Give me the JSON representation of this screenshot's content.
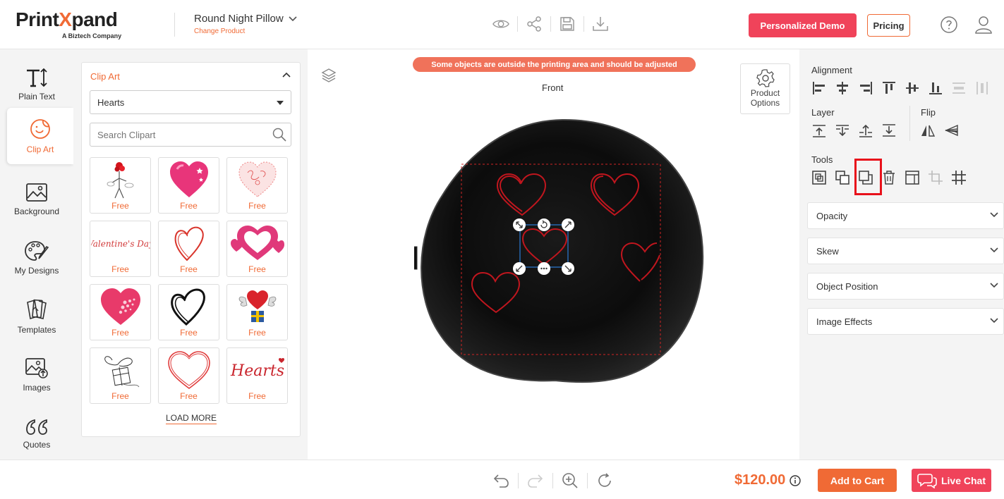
{
  "header": {
    "logo_text_a": "Print",
    "logo_text_x": "X",
    "logo_text_b": "pand",
    "logo_tagline": "A Biztech Company",
    "product_name": "Round Night Pillow",
    "change_product": "Change Product",
    "icons": [
      "eye-icon",
      "share-icon",
      "save-icon",
      "download-icon"
    ],
    "demo_button": "Personalized Demo",
    "pricing_button": "Pricing",
    "colors": {
      "accent": "#f06a35",
      "demo": "#f0435a"
    }
  },
  "left_tools": [
    {
      "label": "Plain Text",
      "icon": "text-icon"
    },
    {
      "label": "Clip Art",
      "icon": "clipart-icon",
      "active": true
    },
    {
      "label": "Background",
      "icon": "background-icon"
    },
    {
      "label": "My Designs",
      "icon": "palette-icon"
    },
    {
      "label": "Templates",
      "icon": "templates-icon"
    },
    {
      "label": "Images",
      "icon": "images-icon"
    },
    {
      "label": "Quotes",
      "icon": "quotes-icon"
    }
  ],
  "clipart": {
    "title": "Clip Art",
    "category": "Hearts",
    "search_placeholder": "Search Clipart",
    "tiles": [
      {
        "label": "Free",
        "icon": "rose-figure-clipart"
      },
      {
        "label": "Free",
        "icon": "pink-heart-stars-clipart"
      },
      {
        "label": "Free",
        "icon": "swirl-heart-clipart"
      },
      {
        "label": "Free",
        "icon": "valentines-day-text-clipart",
        "text": "Valentine's Day"
      },
      {
        "label": "Free",
        "icon": "sketch-heart-clipart"
      },
      {
        "label": "Free",
        "icon": "double-hearts-clipart"
      },
      {
        "label": "Free",
        "icon": "dotted-heart-clipart"
      },
      {
        "label": "Free",
        "icon": "black-scribble-heart-clipart"
      },
      {
        "label": "Free",
        "icon": "winged-heart-gift-clipart"
      },
      {
        "label": "Free",
        "icon": "heart-gift-sketch-clipart"
      },
      {
        "label": "Free",
        "icon": "outline-heart-clipart"
      },
      {
        "label": "Free",
        "icon": "hearts-text-clipart",
        "text": "Hearts"
      }
    ],
    "load_more": "LOAD MORE"
  },
  "canvas": {
    "warning": "Some objects are outside the printing area and should be adjusted",
    "view_label": "Front",
    "product_options": [
      "Product",
      "Options"
    ]
  },
  "right_panel": {
    "alignment_label": "Alignment",
    "layer_label": "Layer",
    "flip_label": "Flip",
    "tools_label": "Tools",
    "accordions": [
      "Opacity",
      "Skew",
      "Object Position",
      "Image Effects"
    ]
  },
  "footer": {
    "price": "$120.00",
    "add_to_cart": "Add to Cart",
    "live_chat": "Live Chat"
  }
}
